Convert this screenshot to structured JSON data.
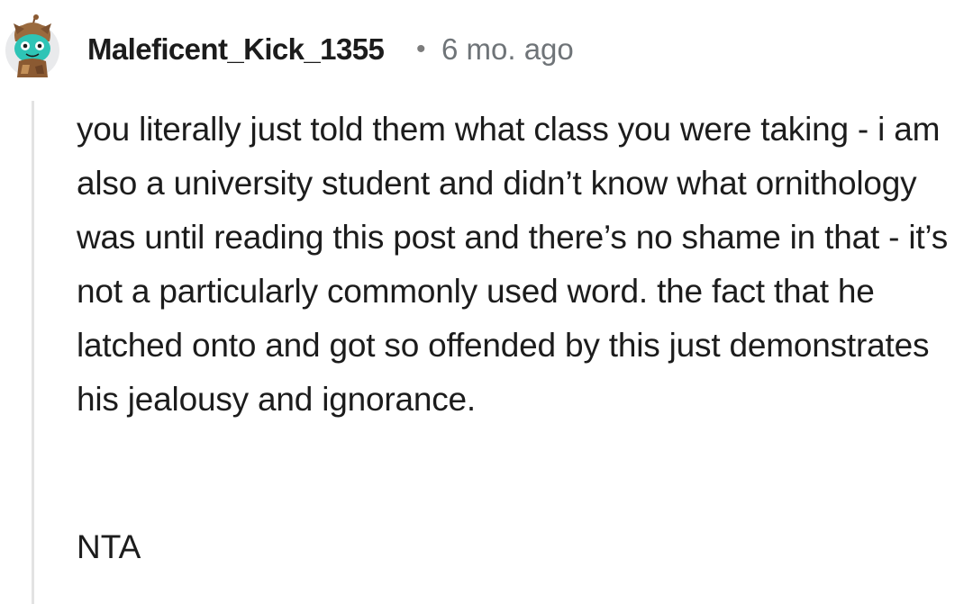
{
  "comment": {
    "author": "Maleficent_Kick_1355",
    "separator": "•",
    "time": "6 mo. ago",
    "avatar_icon": "snoo-avatar-icon",
    "body": "you literally just told them what class you were taking - i am also a university student and didn’t know what ornithology was until reading this post and there’s no shame in that - it’s not a particularly commonly used word. the fact that he latched onto and got so offended by this just demonstrates his jealousy and ignorance.",
    "verdict": "NTA"
  },
  "colors": {
    "thread_line": "#e3e3e3",
    "author_text": "#1c1c1c",
    "time_text": "#6f7478"
  }
}
